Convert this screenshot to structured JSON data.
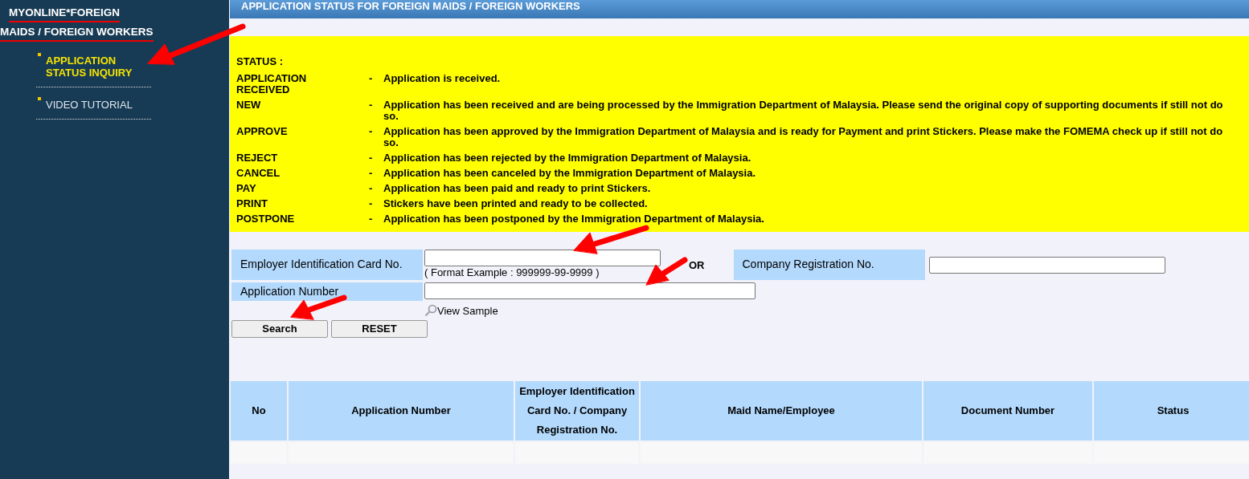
{
  "sidebar": {
    "title_lines": [
      "MYONLINE*FOREIGN",
      "MAIDS / FOREIGN WORKERS"
    ],
    "items": [
      {
        "label": "APPLICATION STATUS INQUIRY",
        "selected": true
      },
      {
        "label": "VIDEO TUTORIAL",
        "selected": false
      }
    ]
  },
  "header": {
    "title": "APPLICATION STATUS FOR FOREIGN MAIDS / FOREIGN WORKERS"
  },
  "status_legend": {
    "title": "STATUS :",
    "rows": [
      {
        "status": "APPLICATION RECEIVED",
        "separator": "-",
        "description": "Application is received."
      },
      {
        "status": "NEW",
        "separator": "-",
        "description": "Application has been received and are being processed by the Immigration Department of Malaysia. Please send the original copy of supporting documents if still not do so."
      },
      {
        "status": "APPROVE",
        "separator": "-",
        "description": "Application has been approved by the Immigration Department of Malaysia and is ready for Payment and print Stickers. Please make the FOMEMA check up if still not do so."
      },
      {
        "status": "REJECT",
        "separator": "-",
        "description": "Application has been rejected by the Immigration Department of Malaysia."
      },
      {
        "status": "CANCEL",
        "separator": "-",
        "description": "Application has been canceled by the Immigration Department of Malaysia."
      },
      {
        "status": "PAY",
        "separator": "-",
        "description": "Application has been paid and ready to print Stickers."
      },
      {
        "status": "PRINT",
        "separator": "-",
        "description": "Stickers have been printed and ready to be collected."
      },
      {
        "status": "POSTPONE",
        "separator": "-",
        "description": "Application has been postponed by the Immigration Department of Malaysia."
      }
    ]
  },
  "form": {
    "ic_label": "Employer Identification Card No.",
    "ic_hint": "( Format Example : 999999-99-9999 )",
    "or_text": "OR",
    "company_label": "Company Registration No.",
    "app_label": "Application Number",
    "view_sample": "View Sample",
    "buttons": [
      "Search",
      "RESET"
    ]
  },
  "table": {
    "columns": [
      "No",
      "Application Number",
      "Employer Identification Card No. / Company Registration No.",
      "Maid Name/Employee",
      "Document Number",
      "Status"
    ]
  }
}
